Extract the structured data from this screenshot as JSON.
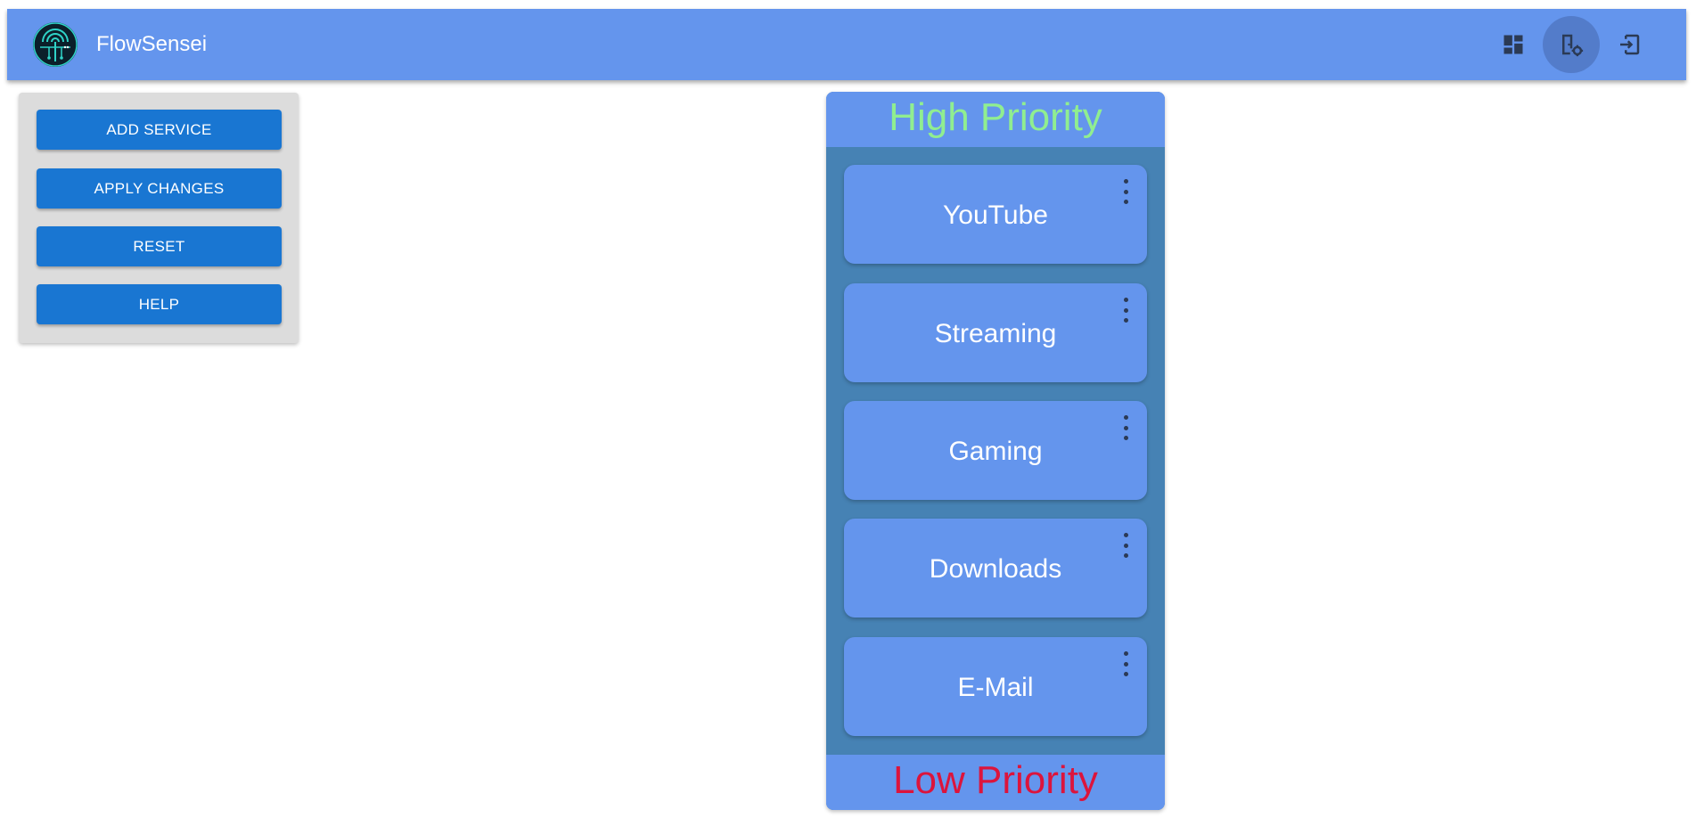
{
  "app": {
    "title": "FlowSensei",
    "logo_icon": "circuit-tree-logo",
    "bar_color": "#6495ed"
  },
  "header_actions": [
    {
      "icon": "dashboard-icon",
      "active": false
    },
    {
      "icon": "settings-icon",
      "active": true
    },
    {
      "icon": "logout-icon",
      "active": false
    }
  ],
  "side_panel": {
    "buttons": [
      {
        "label": "ADD SERVICE"
      },
      {
        "label": "APPLY CHANGES"
      },
      {
        "label": "RESET"
      },
      {
        "label": "HELP"
      }
    ],
    "button_color": "#1976d2"
  },
  "priority_board": {
    "high_label": "High Priority",
    "high_color": "#90ee90",
    "low_label": "Low Priority",
    "low_color": "#dc143c",
    "services": [
      {
        "name": "YouTube"
      },
      {
        "name": "Streaming"
      },
      {
        "name": "Gaming"
      },
      {
        "name": "Downloads"
      },
      {
        "name": "E-Mail"
      }
    ]
  }
}
